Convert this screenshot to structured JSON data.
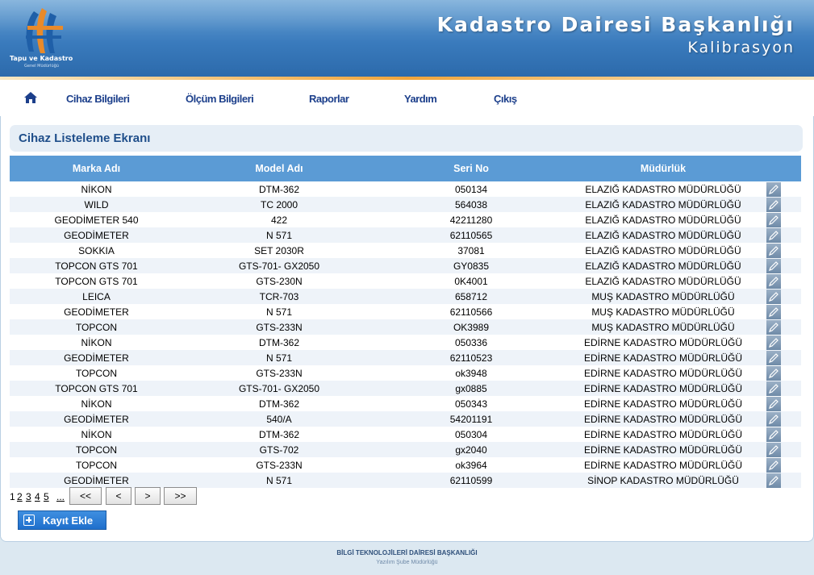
{
  "header": {
    "logo_text": "Tapu ve Kadastro",
    "logo_sub": "Genel Müdürlüğü",
    "title": "Kadastro Dairesi Başkanlığı",
    "subtitle": "Kalibrasyon",
    "accent_colors": {
      "header": "#3a7bbd",
      "line": "#f2a53b"
    }
  },
  "nav": {
    "home_icon": "home-icon",
    "items": [
      {
        "label": "Cihaz Bilgileri"
      },
      {
        "label": "Ölçüm Bilgileri"
      },
      {
        "label": "Raporlar"
      },
      {
        "label": "Yardım"
      },
      {
        "label": "Çıkış"
      }
    ]
  },
  "panel": {
    "title": "Cihaz Listeleme Ekranı"
  },
  "table": {
    "headers": [
      "Marka Adı",
      "Model Adı",
      "Seri No",
      "Müdürlük"
    ],
    "edit_icon": "pencil-icon",
    "rows": [
      [
        "NİKON",
        "DTM-362",
        "050134",
        "ELAZIĞ KADASTRO MÜDÜRLÜĞÜ"
      ],
      [
        "WILD",
        "TC 2000",
        "564038",
        "ELAZIĞ KADASTRO MÜDÜRLÜĞÜ"
      ],
      [
        "GEODİMETER 540",
        "422",
        "42211280",
        "ELAZIĞ KADASTRO MÜDÜRLÜĞÜ"
      ],
      [
        "GEODİMETER",
        "N 571",
        "62110565",
        "ELAZIĞ KADASTRO MÜDÜRLÜĞÜ"
      ],
      [
        "SOKKIA",
        "SET 2030R",
        "37081",
        "ELAZIĞ KADASTRO MÜDÜRLÜĞÜ"
      ],
      [
        "TOPCON GTS 701",
        "GTS-701- GX2050",
        "GY0835",
        "ELAZIĞ KADASTRO MÜDÜRLÜĞÜ"
      ],
      [
        "TOPCON GTS 701",
        "GTS-230N",
        "0K4001",
        "ELAZIĞ KADASTRO MÜDÜRLÜĞÜ"
      ],
      [
        "LEICA",
        "TCR-703",
        "658712",
        "MUŞ KADASTRO MÜDÜRLÜĞÜ"
      ],
      [
        "GEODİMETER",
        "N 571",
        "62110566",
        "MUŞ KADASTRO MÜDÜRLÜĞÜ"
      ],
      [
        "TOPCON",
        "GTS-233N",
        "OK3989",
        "MUŞ KADASTRO MÜDÜRLÜĞÜ"
      ],
      [
        "NİKON",
        "DTM-362",
        "050336",
        "EDİRNE KADASTRO MÜDÜRLÜĞÜ"
      ],
      [
        "GEODİMETER",
        "N 571",
        "62110523",
        "EDİRNE KADASTRO MÜDÜRLÜĞÜ"
      ],
      [
        "TOPCON",
        "GTS-233N",
        "ok3948",
        "EDİRNE KADASTRO MÜDÜRLÜĞÜ"
      ],
      [
        "TOPCON GTS 701",
        "GTS-701- GX2050",
        "gx0885",
        "EDİRNE KADASTRO MÜDÜRLÜĞÜ"
      ],
      [
        "NİKON",
        "DTM-362",
        "050343",
        "EDİRNE KADASTRO MÜDÜRLÜĞÜ"
      ],
      [
        "GEODİMETER",
        "540/A",
        "54201191",
        "EDİRNE KADASTRO MÜDÜRLÜĞÜ"
      ],
      [
        "NİKON",
        "DTM-362",
        "050304",
        "EDİRNE KADASTRO MÜDÜRLÜĞÜ"
      ],
      [
        "TOPCON",
        "GTS-702",
        "gx2040",
        "EDİRNE KADASTRO MÜDÜRLÜĞÜ"
      ],
      [
        "TOPCON",
        "GTS-233N",
        "ok3964",
        "EDİRNE KADASTRO MÜDÜRLÜĞÜ"
      ],
      [
        "GEODİMETER",
        "N 571",
        "62110599",
        "SİNOP KADASTRO MÜDÜRLÜĞÜ"
      ]
    ]
  },
  "pager": {
    "current": "1",
    "pages": [
      "2",
      "3",
      "4",
      "5"
    ],
    "more": "...",
    "first": "<<",
    "prev": "<",
    "next": ">",
    "last": ">>"
  },
  "add_button": {
    "label": "Kayıt Ekle"
  },
  "footer": {
    "line1": "BİLGİ TEKNOLOJİLERİ DAİRESİ BAŞKANLIĞI",
    "line2": "Yazılım Şube Müdürlüğü"
  }
}
